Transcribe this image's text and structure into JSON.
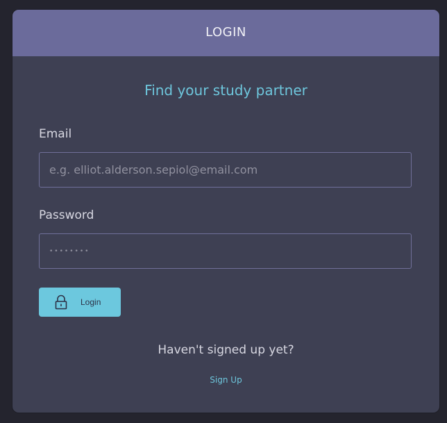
{
  "header": {
    "title": "LOGIN"
  },
  "subtitle": "Find your study partner",
  "form": {
    "email_label": "Email",
    "email_placeholder": "e.g. elliot.alderson.sepiol@email.com",
    "password_label": "Password",
    "password_placeholder": "••••••••",
    "login_button_label": "Login",
    "login_button_icon": "lock-icon"
  },
  "footer": {
    "prompt": "Haven't signed up yet?",
    "signup_link": "Sign Up"
  },
  "colors": {
    "background": "#24242e",
    "card": "#3e4053",
    "header": "#6b6b9b",
    "accent": "#6ec6dc"
  }
}
